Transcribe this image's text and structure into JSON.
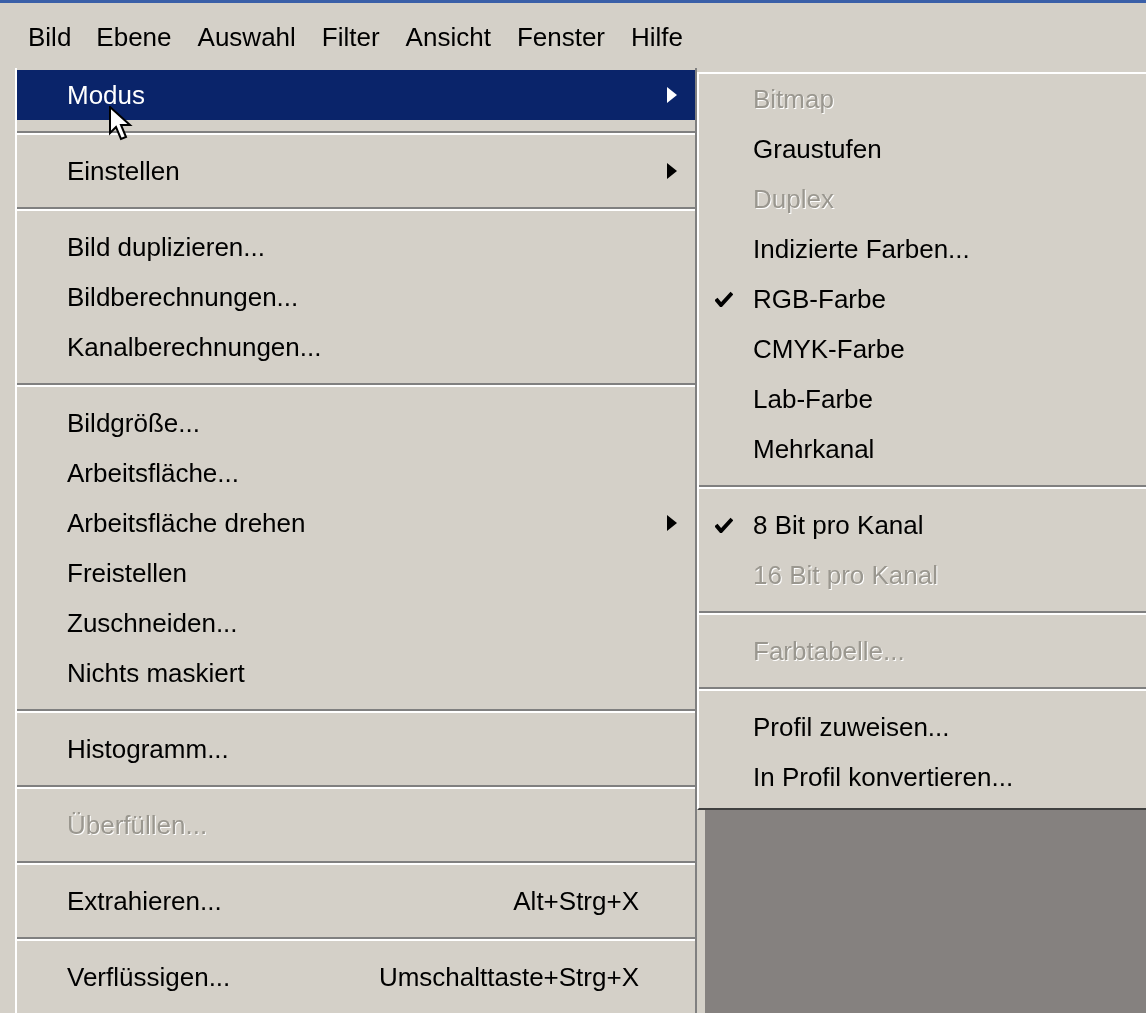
{
  "menubar": [
    {
      "label": "Bild",
      "selected": true
    },
    {
      "label": "Ebene",
      "selected": false
    },
    {
      "label": "Auswahl",
      "selected": false
    },
    {
      "label": "Filter",
      "selected": false
    },
    {
      "label": "Ansicht",
      "selected": false
    },
    {
      "label": "Fenster",
      "selected": false
    },
    {
      "label": "Hilfe",
      "selected": false
    }
  ],
  "menu": {
    "sections": [
      [
        {
          "label": "Modus",
          "selected": true,
          "disabled": false,
          "submenu": true
        }
      ],
      [
        {
          "label": "Einstellen",
          "selected": false,
          "disabled": false,
          "submenu": true
        }
      ],
      [
        {
          "label": "Bild duplizieren...",
          "selected": false,
          "disabled": false,
          "submenu": false
        },
        {
          "label": "Bildberechnungen...",
          "selected": false,
          "disabled": false,
          "submenu": false
        },
        {
          "label": "Kanalberechnungen...",
          "selected": false,
          "disabled": false,
          "submenu": false
        }
      ],
      [
        {
          "label": "Bildgröße...",
          "selected": false,
          "disabled": false,
          "submenu": false
        },
        {
          "label": "Arbeitsfläche...",
          "selected": false,
          "disabled": false,
          "submenu": false
        },
        {
          "label": "Arbeitsfläche drehen",
          "selected": false,
          "disabled": false,
          "submenu": true
        },
        {
          "label": "Freistellen",
          "selected": false,
          "disabled": false,
          "submenu": false
        },
        {
          "label": "Zuschneiden...",
          "selected": false,
          "disabled": false,
          "submenu": false
        },
        {
          "label": "Nichts maskiert",
          "selected": false,
          "disabled": false,
          "submenu": false
        }
      ],
      [
        {
          "label": "Histogramm...",
          "selected": false,
          "disabled": false,
          "submenu": false
        }
      ],
      [
        {
          "label": "Überfüllen...",
          "selected": false,
          "disabled": true,
          "submenu": false
        }
      ],
      [
        {
          "label": "Extrahieren...",
          "selected": false,
          "disabled": false,
          "submenu": false,
          "shortcut": "Alt+Strg+X"
        }
      ],
      [
        {
          "label": "Verflüssigen...",
          "selected": false,
          "disabled": false,
          "submenu": false,
          "shortcut": "Umschalttaste+Strg+X"
        }
      ]
    ]
  },
  "submenu": {
    "sections": [
      [
        {
          "label": "Bitmap",
          "checked": false,
          "disabled": true
        },
        {
          "label": "Graustufen",
          "checked": false,
          "disabled": false
        },
        {
          "label": "Duplex",
          "checked": false,
          "disabled": true
        },
        {
          "label": "Indizierte Farben...",
          "checked": false,
          "disabled": false
        },
        {
          "label": "RGB-Farbe",
          "checked": true,
          "disabled": false
        },
        {
          "label": "CMYK-Farbe",
          "checked": false,
          "disabled": false
        },
        {
          "label": "Lab-Farbe",
          "checked": false,
          "disabled": false
        },
        {
          "label": "Mehrkanal",
          "checked": false,
          "disabled": false
        }
      ],
      [
        {
          "label": "8 Bit pro Kanal",
          "checked": true,
          "disabled": false
        },
        {
          "label": "16 Bit pro Kanal",
          "checked": false,
          "disabled": true
        }
      ],
      [
        {
          "label": "Farbtabelle...",
          "checked": false,
          "disabled": true
        }
      ],
      [
        {
          "label": "Profil zuweisen...",
          "checked": false,
          "disabled": false
        },
        {
          "label": "In Profil konvertieren...",
          "checked": false,
          "disabled": false
        }
      ]
    ]
  }
}
